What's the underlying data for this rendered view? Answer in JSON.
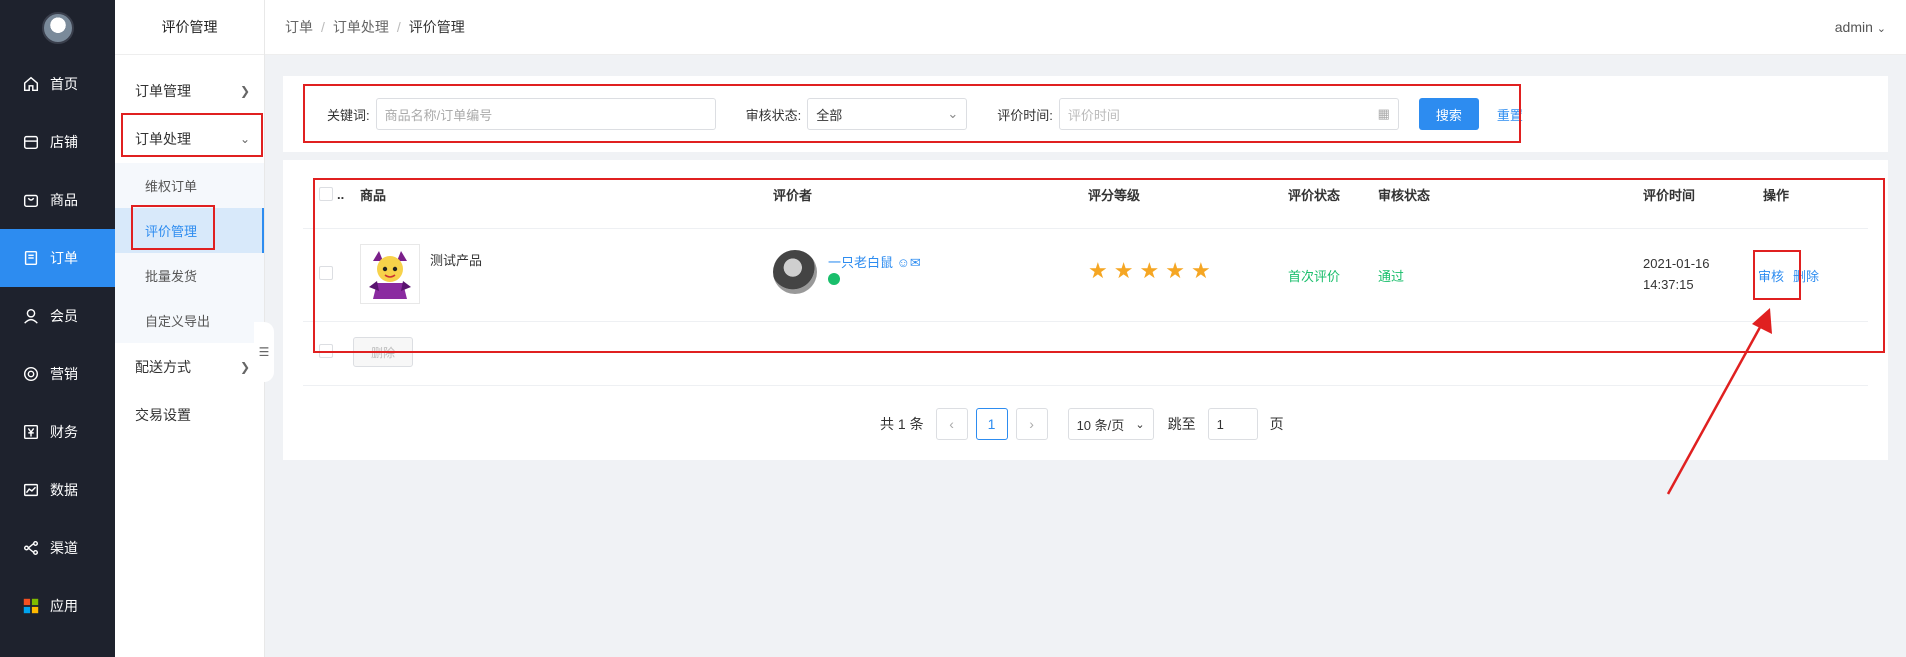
{
  "sidebar": {
    "items": [
      {
        "label": "首页",
        "icon": "home-icon"
      },
      {
        "label": "店铺",
        "icon": "store-icon"
      },
      {
        "label": "商品",
        "icon": "bag-icon"
      },
      {
        "label": "订单",
        "icon": "order-icon"
      },
      {
        "label": "会员",
        "icon": "user-icon"
      },
      {
        "label": "营销",
        "icon": "marketing-icon"
      },
      {
        "label": "财务",
        "icon": "finance-icon"
      },
      {
        "label": "数据",
        "icon": "chart-icon"
      },
      {
        "label": "渠道",
        "icon": "share-icon"
      },
      {
        "label": "应用",
        "icon": "apps-icon"
      }
    ],
    "active_index": 3
  },
  "subnav": {
    "title": "评价管理",
    "group1": "订单管理",
    "group2": "订单处理",
    "items": [
      "维权订单",
      "评价管理",
      "批量发货",
      "自定义导出"
    ],
    "group3": "配送方式",
    "group4": "交易设置"
  },
  "header": {
    "crumb1": "订单",
    "crumb2": "订单处理",
    "crumb3": "评价管理",
    "user": "admin"
  },
  "filter": {
    "keyword_label": "关键词:",
    "keyword_placeholder": "商品名称/订单编号",
    "status_label": "审核状态:",
    "status_value": "全部",
    "time_label": "评价时间:",
    "time_placeholder": "评价时间",
    "search": "搜索",
    "reset": "重置"
  },
  "table": {
    "headers": {
      "product": "商品",
      "reviewer": "评价者",
      "rating": "评分等级",
      "review_status": "评价状态",
      "audit_status": "审核状态",
      "time": "评价时间",
      "action": "操作"
    },
    "rows": [
      {
        "product": "测试产品",
        "reviewer": "一只老白鼠",
        "stars": 5,
        "review_status": "首次评价",
        "audit_status": "通过",
        "date": "2021-01-16",
        "time": "14:37:15",
        "audit_btn": "审核",
        "delete_btn": "删除"
      }
    ],
    "bulk_delete": "删除"
  },
  "pager": {
    "total": "共 1 条",
    "current": "1",
    "size": "10 条/页",
    "jump_label": "跳至",
    "jump_value": "1",
    "page_suffix": "页"
  },
  "colors": {
    "accent": "#2d8cf0",
    "sidebar": "#1e222d",
    "success": "#19be6b",
    "star": "#f5a623",
    "annotation": "#e02020"
  }
}
